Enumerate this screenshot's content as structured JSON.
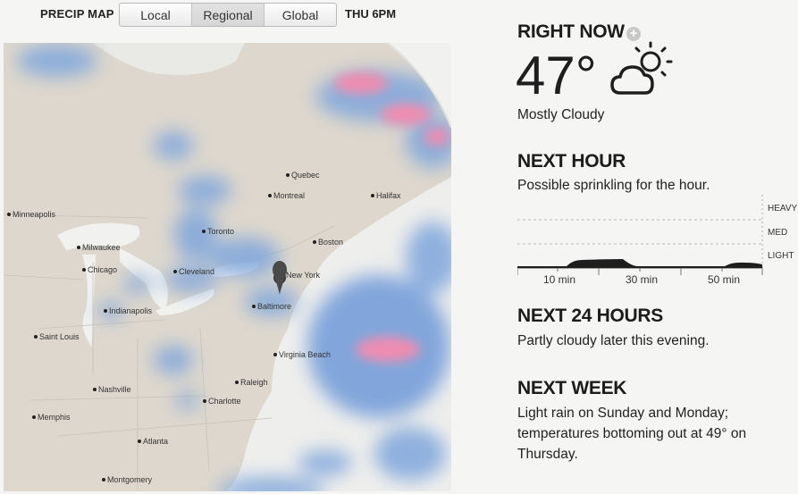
{
  "toolbar": {
    "title": "PRECIP MAP",
    "tabs": [
      {
        "label": "Local"
      },
      {
        "label": "Regional"
      },
      {
        "label": "Global"
      }
    ],
    "active_tab": "Regional",
    "time": "THU 6PM"
  },
  "map": {
    "cities": [
      {
        "name": "Quebec"
      },
      {
        "name": "Montreal"
      },
      {
        "name": "Halifax"
      },
      {
        "name": "Minneapolis"
      },
      {
        "name": "Toronto"
      },
      {
        "name": "Boston"
      },
      {
        "name": "Milwaukee"
      },
      {
        "name": "Chicago"
      },
      {
        "name": "Cleveland"
      },
      {
        "name": "New York"
      },
      {
        "name": "Baltimore"
      },
      {
        "name": "Indianapolis"
      },
      {
        "name": "Saint Louis"
      },
      {
        "name": "Virginia Beach"
      },
      {
        "name": "Raleigh"
      },
      {
        "name": "Nashville"
      },
      {
        "name": "Charlotte"
      },
      {
        "name": "Memphis"
      },
      {
        "name": "Atlanta"
      },
      {
        "name": "Montgomery"
      }
    ],
    "selected_city": "New York",
    "colors": {
      "land": "#ddd6cc",
      "precip_light": "#7fa6dc",
      "precip_heavy": "#f08cb0"
    }
  },
  "right_now": {
    "heading": "RIGHT NOW",
    "temperature": "47°",
    "summary": "Mostly Cloudy",
    "icon": "partly-cloudy-icon"
  },
  "next_hour": {
    "heading": "NEXT HOUR",
    "summary": "Possible sprinkling for the hour.",
    "levels": [
      "HEAVY",
      "MED",
      "LIGHT"
    ],
    "ticks": [
      "10 min",
      "30 min",
      "50 min"
    ]
  },
  "next_24": {
    "heading": "NEXT 24 HOURS",
    "summary": "Partly cloudy later this evening."
  },
  "next_week": {
    "heading": "NEXT WEEK",
    "line1": "Light rain on Sunday and Monday;",
    "line2": "temperatures bottoming out at 49° on",
    "line3": "Thursday."
  }
}
